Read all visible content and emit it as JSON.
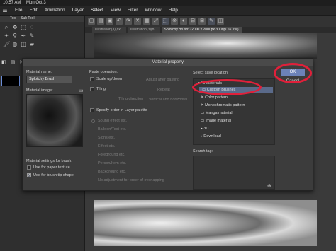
{
  "status": {
    "time": "10:57 AM",
    "date": "Mon Oct 3"
  },
  "menu": [
    "File",
    "Edit",
    "Animation",
    "Layer",
    "Select",
    "View",
    "Filter",
    "Window",
    "Help"
  ],
  "tool_panel": {
    "tab1": "Tool",
    "tab2": "Sub Tool"
  },
  "doc_tabs": [
    "Illustration(3)(8x...",
    "Illustration(3)(8...",
    "Splotchy Brush* (2000 x 2000px 300dpi 65.1%)"
  ],
  "dialog": {
    "title": "Material property",
    "material_name_label": "Material name:",
    "material_name_value": "Splotchy Brush",
    "material_image_label": "Material image:",
    "settings_label": "Material settings for brush:",
    "use_paper_texture": "Use for paper texture",
    "use_brush_tip": "Use for brush tip shape",
    "paste_label": "Paste operation:",
    "scale_up_down": "Scale up/down",
    "tiling": "Tiling",
    "tiling_direction": "Tiling direction",
    "adjust_pasting": "Adjust after pasting",
    "repeat": "Repeat",
    "vertical_horizontal": "Vertical and horizontal",
    "specify_order": "Specify order in Layer palette",
    "order_options": [
      "Sound effect etc.",
      "Balloon/Text etc.",
      "Signs etc.",
      "Effect etc.",
      "Foreground etc.",
      "Person/Item etc.",
      "Background etc.",
      "No adjustment for order of overlapping"
    ],
    "save_location_label": "Select save location:",
    "tree": [
      "All materials",
      "Custom Brushes",
      "Color pattern",
      "Monochromatic pattern",
      "Manga material",
      "Image material",
      "3D",
      "Download"
    ],
    "search_tag_label": "Search tag:",
    "ok": "OK",
    "cancel": "Cancel"
  },
  "colors": {
    "highlight_ring": "#e0203a",
    "ok_button": "#6c82b8",
    "selected_row": "#5a6a8a"
  }
}
